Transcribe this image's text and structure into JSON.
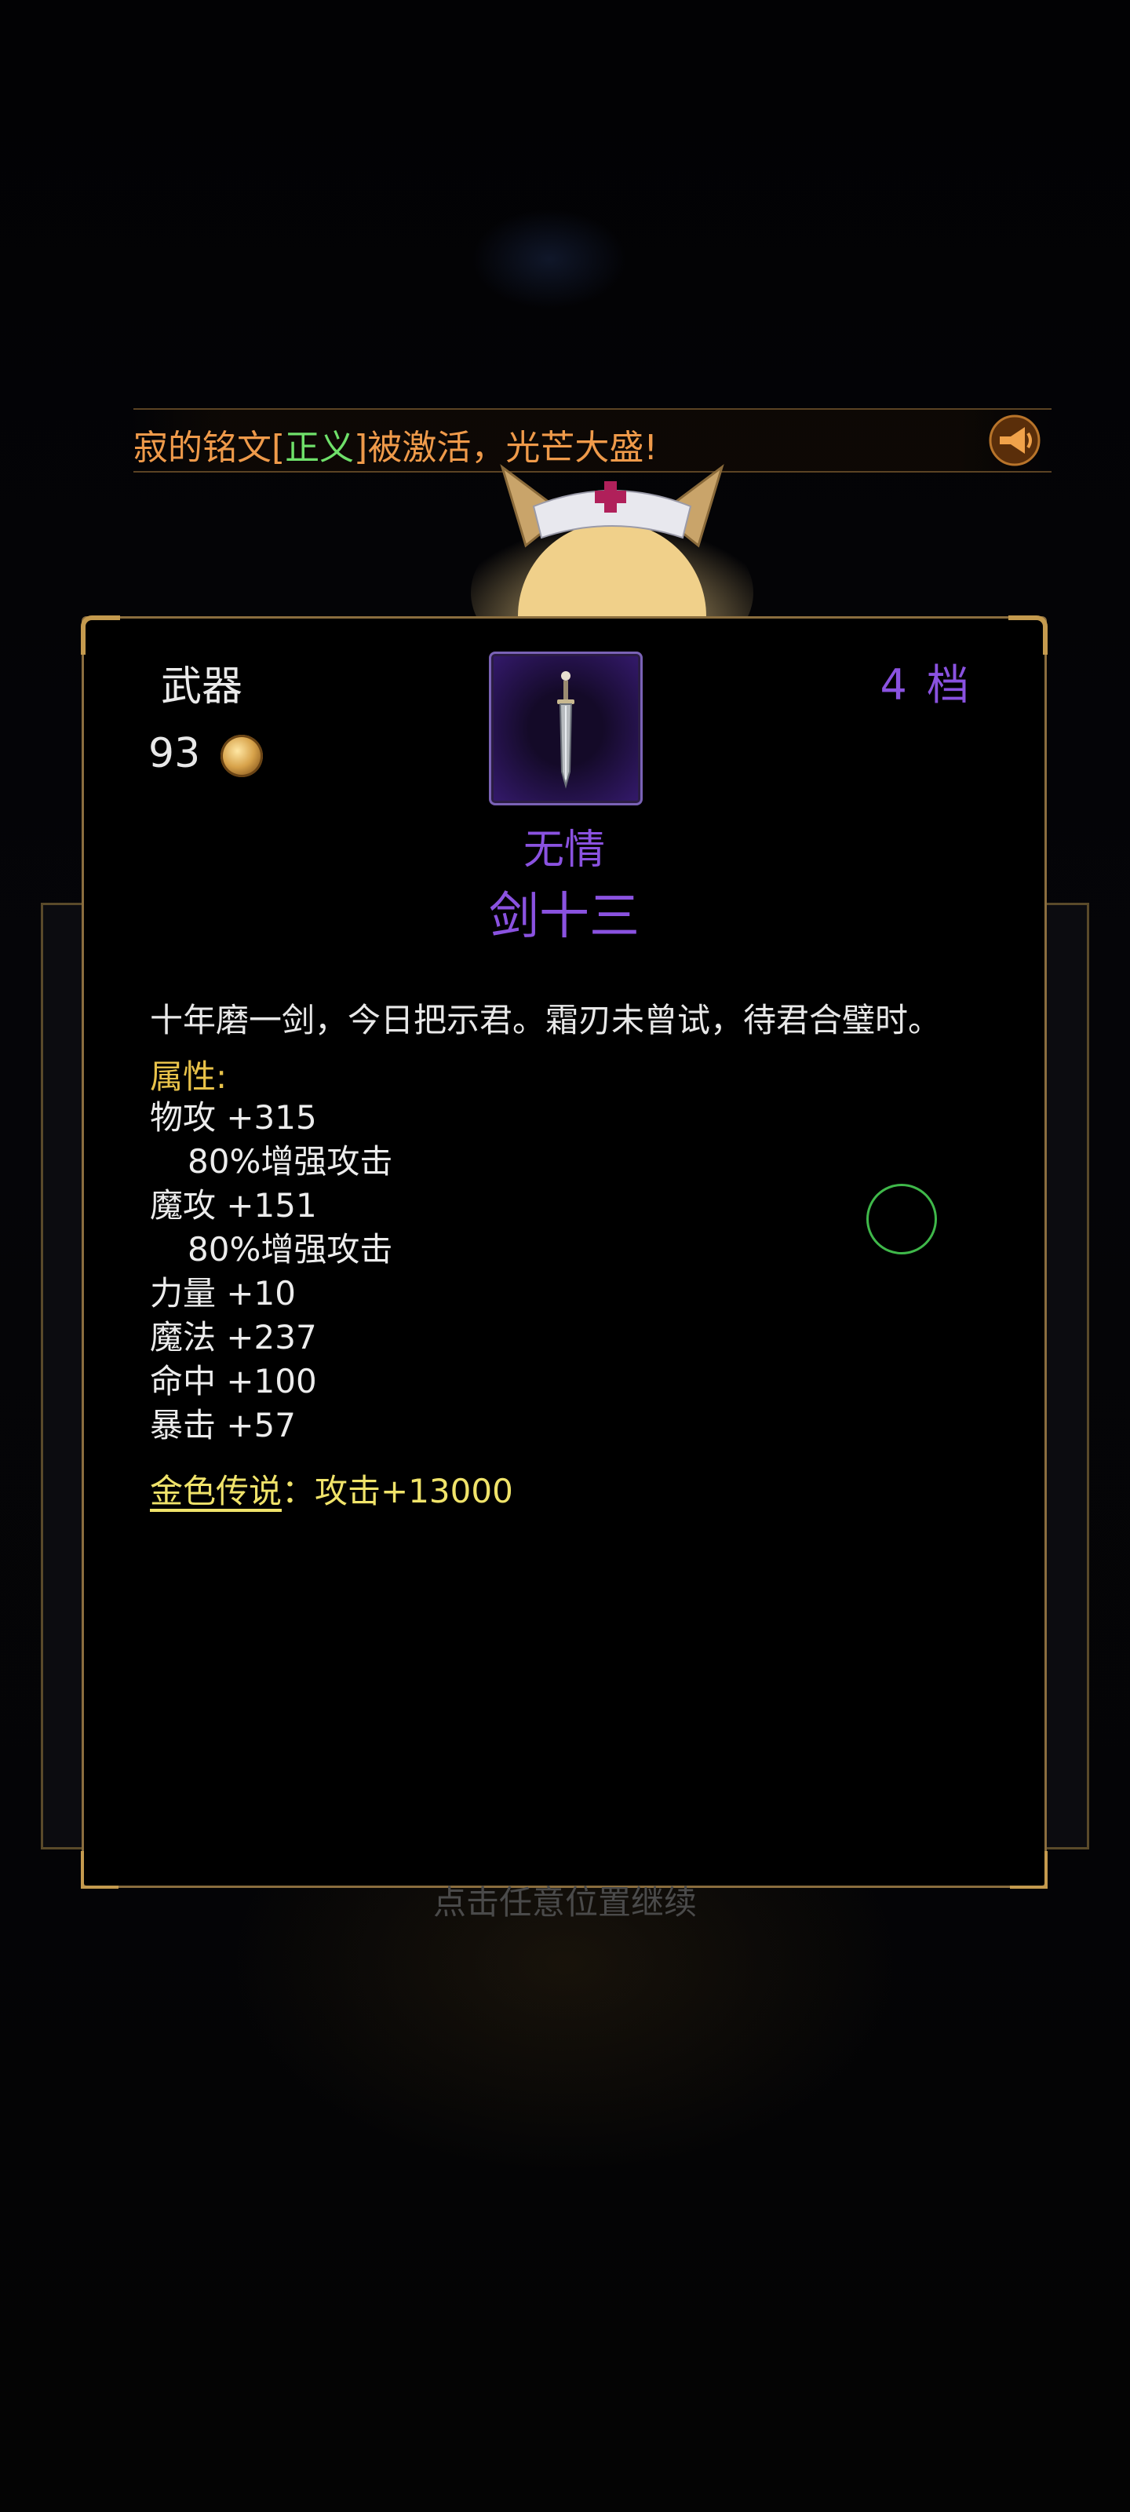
{
  "broadcast": {
    "text_before": "寂的铭文[",
    "highlight": "正义",
    "text_after": "]被激活，光芒大盛!"
  },
  "item": {
    "slot": "武器",
    "price": "93",
    "tier_number": "4",
    "tier_unit": "档",
    "prefix": "无情",
    "name": "剑十三",
    "description": "十年磨一剑，今日把示君。霜刃未曾试，待君合璧时。",
    "attributes_title": "属性:",
    "attributes": [
      "物攻 +315",
      "80%增强攻击",
      "魔攻 +151",
      "80%增强攻击",
      "力量 +10",
      "魔法 +237",
      "命中 +100",
      "暴击 +57"
    ],
    "legend_name": "金色传说",
    "legend_effect": "：攻击+13000"
  },
  "hint": "点击任意位置继续",
  "colors": {
    "accent_purple": "#8a52e0",
    "gold_text": "#e8c24a",
    "legend_text": "#f0e36a",
    "broadcast_text": "#ef9a4a",
    "broadcast_highlight": "#6fe06a",
    "frame_gold": "#8a6d3e"
  },
  "icons": {
    "horn": "horn-icon",
    "coin": "coin-icon",
    "item": "sword-icon"
  }
}
